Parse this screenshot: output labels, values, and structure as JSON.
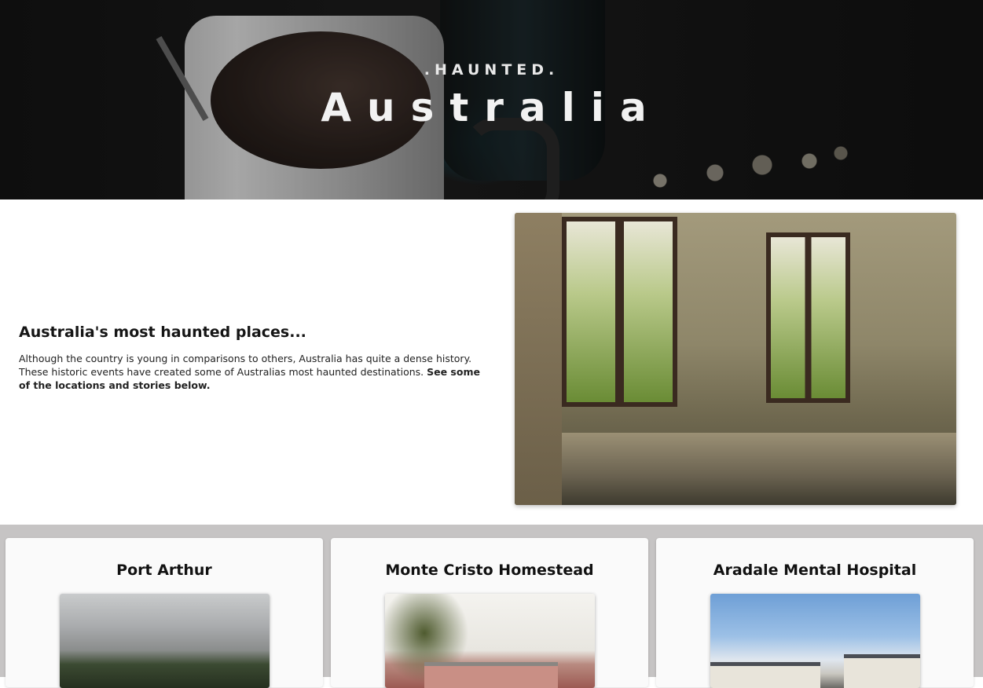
{
  "hero": {
    "subtitle": ".HAUNTED.",
    "title": "Australia"
  },
  "intro": {
    "heading": "Australia's most haunted places...",
    "paragraph": "Although the country is young in comparisons to others, Australia has quite a dense history. These historic events have created some of Australias most haunted destinations.",
    "paragraph_emphasis": "See some of the locations and stories below."
  },
  "cards": [
    {
      "title": "Port Arthur"
    },
    {
      "title": "Monte Cristo Homestead"
    },
    {
      "title": "Aradale Mental Hospital"
    }
  ],
  "colors": {
    "page_background": "#ffffff",
    "cards_section_background": "#c6c4c4",
    "card_background": "#fafafa",
    "hero_text": "#f2f2f2"
  }
}
